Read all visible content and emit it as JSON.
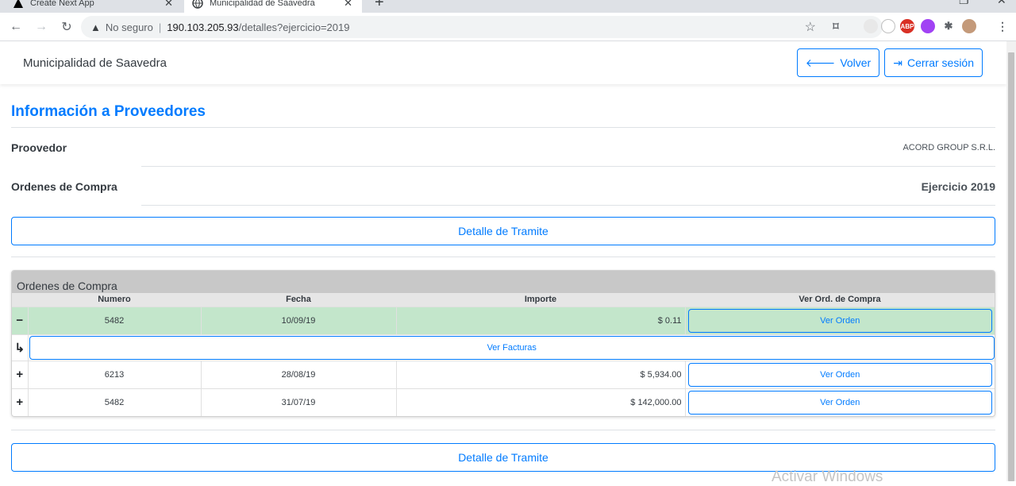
{
  "browser": {
    "tabs": [
      {
        "title": "Create Next App"
      },
      {
        "title": "Municipalidad de Saavedra"
      }
    ],
    "omnibox": {
      "insecure_label": "No seguro",
      "host": "190.103.205.93",
      "path": "/detalles?ejercicio=2019"
    }
  },
  "navbar": {
    "brand": "Municipalidad de Saavedra",
    "back_label": "Volver",
    "logout_label": "Cerrar sesión"
  },
  "main": {
    "title": "Información a Proveedores",
    "proveedor_label": "Proovedor",
    "proveedor_value": "ACORD GROUP S.R.L.",
    "ordenes_label": "Ordenes de Compra",
    "ejercicio_value": "Ejercicio 2019",
    "detalle_label": "Detalle de Tramite"
  },
  "ordenes": {
    "title": "Ordenes de Compra",
    "columns": [
      "Numero",
      "Fecha",
      "Importe",
      "Ver Ord. de Compra"
    ],
    "rows": [
      {
        "expander": "−",
        "numero": "5482",
        "fecha": "10/09/19",
        "importe": "$ 0.11",
        "action": "Ver Orden"
      },
      {
        "expander": "+",
        "numero": "6213",
        "fecha": "28/08/19",
        "importe": "$ 5,934.00",
        "action": "Ver Orden"
      },
      {
        "expander": "+",
        "numero": "5482",
        "fecha": "31/07/19",
        "importe": "$ 142,000.00",
        "action": "Ver Orden"
      }
    ],
    "subrow": {
      "arrow": "↳",
      "label": "Ver Facturas"
    }
  },
  "footer": {
    "detalle_label": "Detalle de Tramite",
    "watermark": "Activar Windows"
  },
  "colors": {
    "primary": "#007bff",
    "selected_row": "#c3e6cb",
    "card_header": "#c8c8c8"
  }
}
